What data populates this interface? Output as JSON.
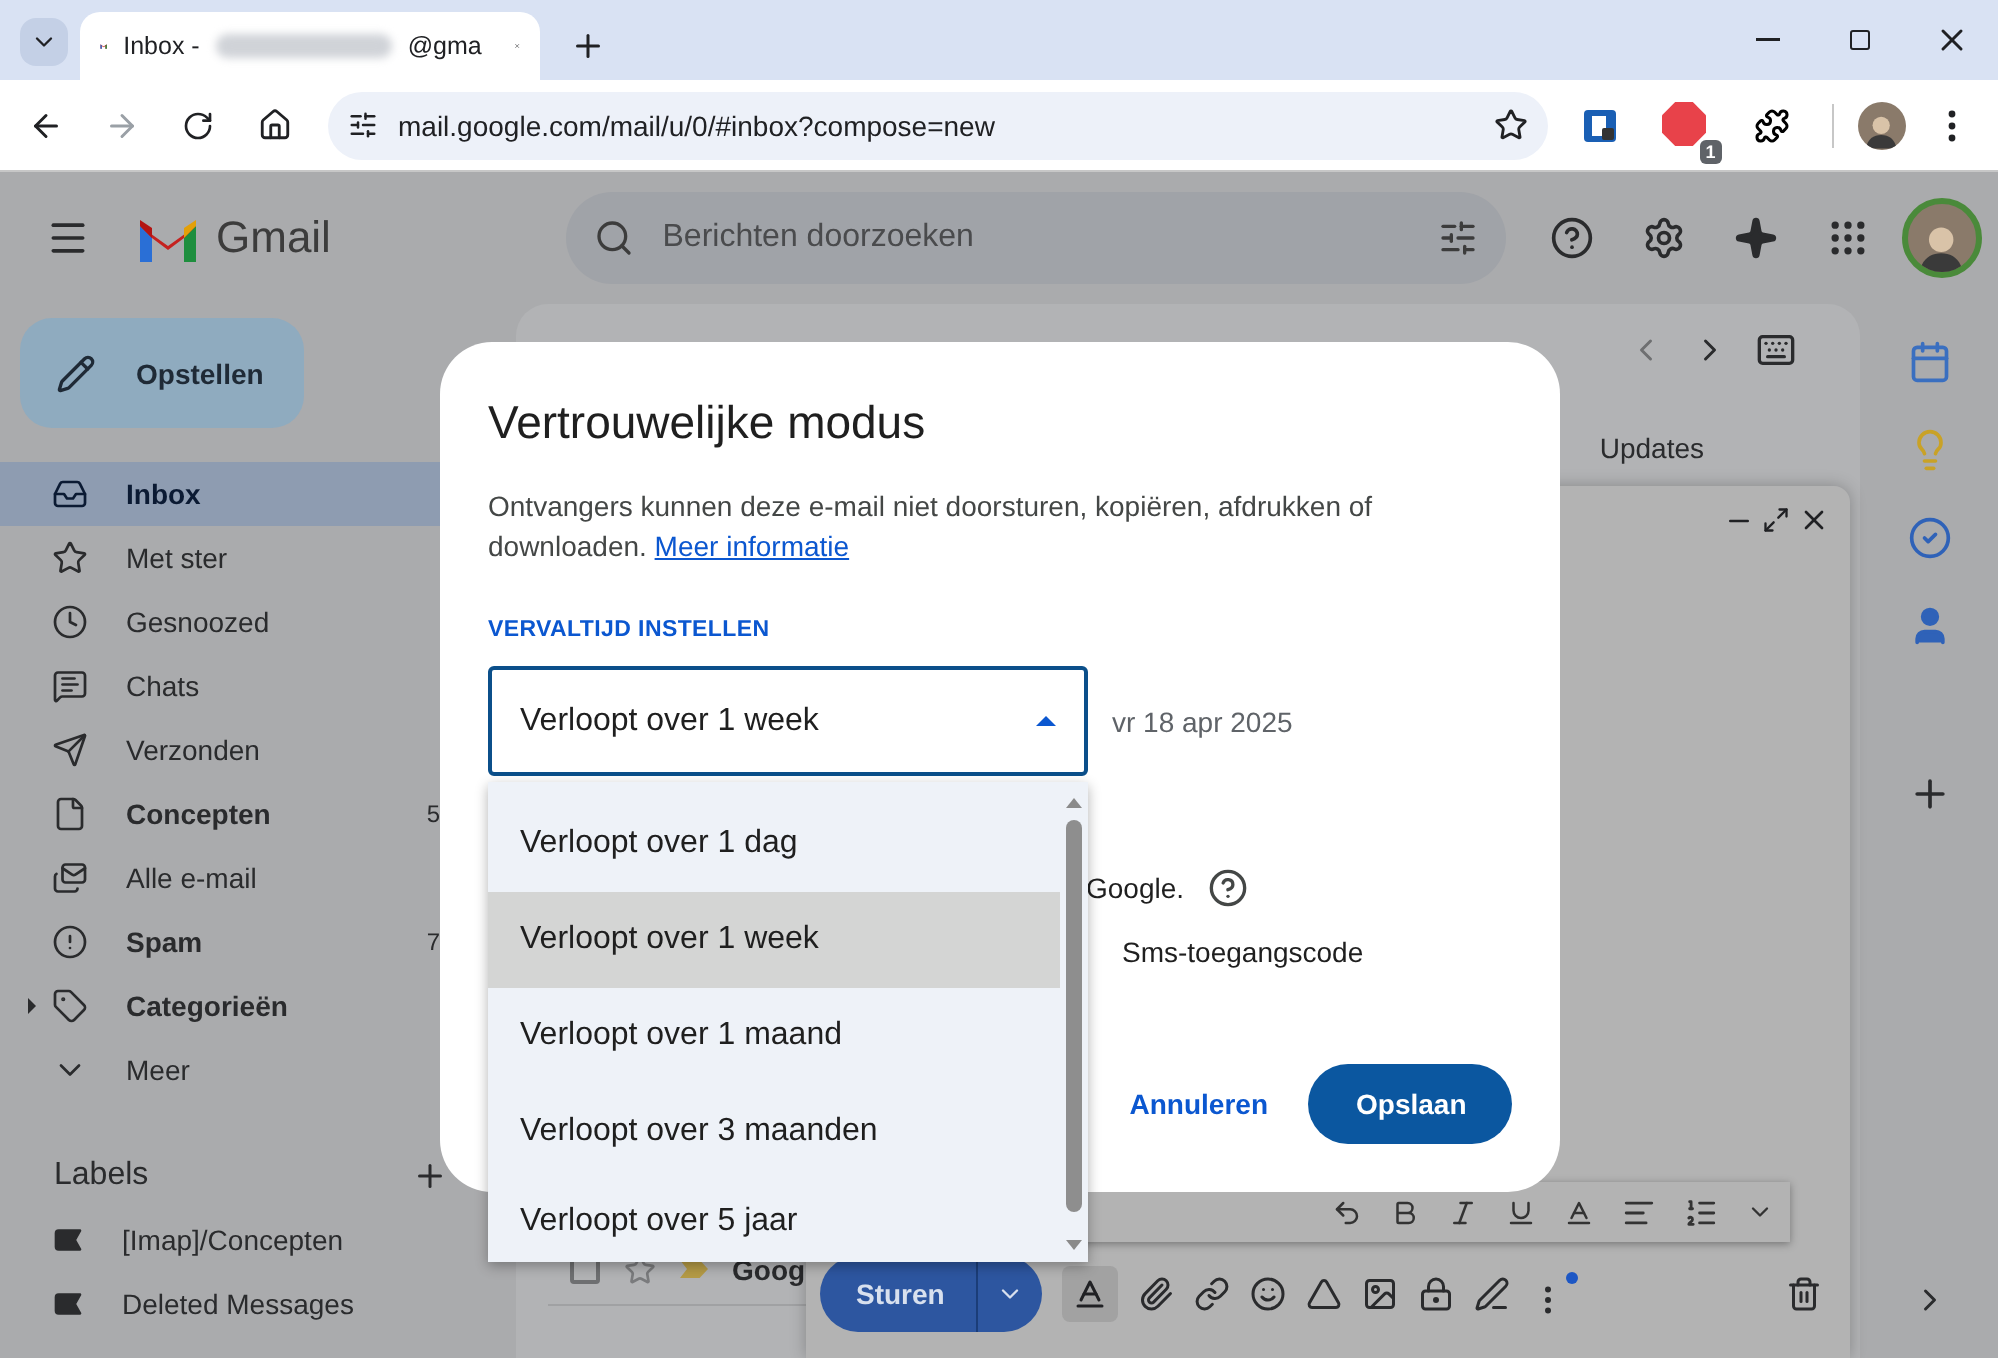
{
  "browser": {
    "tab": {
      "title_start": "Inbox -",
      "title_end": "@gma"
    },
    "address": "mail.google.com/mail/u/0/#inbox?compose=new",
    "extension_badge": "1"
  },
  "header": {
    "app_name": "Gmail",
    "search": {
      "placeholder": "Berichten doorzoeken"
    }
  },
  "compose_button": "Opstellen",
  "sidebar": {
    "items": [
      {
        "label": "Inbox",
        "selected": true,
        "unread": true,
        "expandable": false
      },
      {
        "label": "Met ster",
        "selected": false,
        "unread": false,
        "expandable": false
      },
      {
        "label": "Gesnoozed",
        "selected": false,
        "unread": false,
        "expandable": false
      },
      {
        "label": "Chats",
        "selected": false,
        "unread": false,
        "expandable": false
      },
      {
        "label": "Verzonden",
        "selected": false,
        "unread": false,
        "expandable": false
      },
      {
        "label": "Concepten",
        "selected": false,
        "unread": true,
        "expandable": false,
        "count": "5"
      },
      {
        "label": "Alle e-mail",
        "selected": false,
        "unread": false,
        "expandable": false
      },
      {
        "label": "Spam",
        "selected": false,
        "unread": true,
        "expandable": false,
        "count": "7"
      },
      {
        "label": "Categorieën",
        "selected": false,
        "unread": true,
        "expandable": true
      },
      {
        "label": "Meer",
        "selected": false,
        "unread": false,
        "expandable": false
      }
    ],
    "labels_title": "Labels",
    "labels": [
      {
        "label": "[Imap]/Concepten"
      },
      {
        "label": "Deleted Messages"
      }
    ]
  },
  "mail": {
    "tabs": [
      {
        "label": "Updates",
        "selected": false
      }
    ],
    "rows": [
      {
        "sender": "Goog",
        "starred": false,
        "checked": false
      }
    ]
  },
  "dialog": {
    "title": "Vertrouwelijke modus",
    "description": "Ontvangers kunnen deze e-mail niet doorsturen, kopiëren, afdrukken of downloaden.",
    "link": "Meer informatie",
    "section_label": "VERVALTIJD INSTELLEN",
    "expiry": {
      "value": "Verloopt over 1 week",
      "expanded": true,
      "options": [
        {
          "label": "Verloopt over 1 dag",
          "selected": false
        },
        {
          "label": "Verloopt over 1 week",
          "selected": true
        },
        {
          "label": "Verloopt over 1 maand",
          "selected": false
        },
        {
          "label": "Verloopt over 3 maanden",
          "selected": false
        },
        {
          "label": "Verloopt over 5 jaar",
          "selected": false
        }
      ]
    },
    "expiry_date": "vr 18 apr 2025",
    "passcode_note": "Google.",
    "passcode_option": "Sms-toegangscode",
    "buttons": {
      "cancel": "Annuleren",
      "save": "Opslaan"
    }
  },
  "compose": {
    "send": "Sturen"
  }
}
